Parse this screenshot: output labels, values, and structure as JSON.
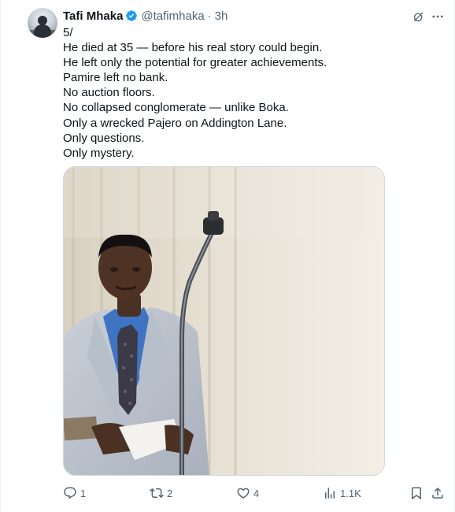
{
  "tweet": {
    "author_name": "Tafi Mhaka",
    "handle": "@tafimhaka",
    "separator": "·",
    "timestamp": "3h",
    "lines": [
      "5/",
      "He died at 35 — before his real story could begin.",
      "He left only the potential for greater achievements.",
      "Pamire left no bank.",
      "No auction floors.",
      "No collapsed conglomerate — unlike Boka.",
      "Only a wrecked Pajero on Addington Lane.",
      "Only questions.",
      "Only mystery."
    ]
  },
  "metrics": {
    "replies": "1",
    "reposts": "2",
    "likes": "4",
    "views": "1.1K"
  },
  "icons": {
    "verified": "verified-badge-icon",
    "grok": "grok-icon",
    "more": "more-icon",
    "reply": "reply-icon",
    "repost": "repost-icon",
    "like": "like-icon",
    "views": "views-icon",
    "bookmark": "bookmark-icon",
    "share": "share-icon"
  },
  "colors": {
    "accent": "#1d9bf0",
    "text": "#0f1419",
    "muted": "#536471",
    "border": "#cfd9de"
  }
}
